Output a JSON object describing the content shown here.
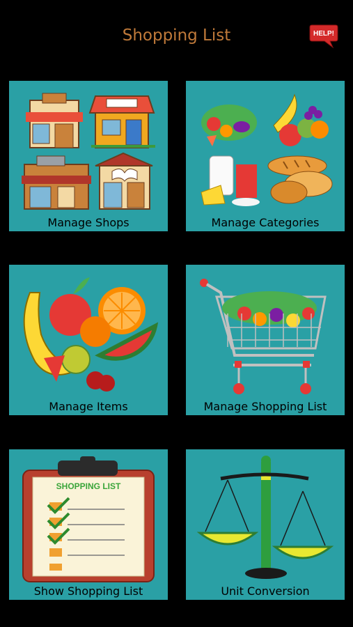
{
  "header": {
    "title": "Shopping List",
    "help_label": "HELP!"
  },
  "tiles": [
    {
      "label": "Manage Shops",
      "icon": "shops-icon"
    },
    {
      "label": "Manage Categories",
      "icon": "categories-icon"
    },
    {
      "label": "Manage Items",
      "icon": "fruits-icon"
    },
    {
      "label": "Manage Shopping List",
      "icon": "shopping-cart-icon"
    },
    {
      "label": "Show Shopping List",
      "icon": "clipboard-icon",
      "clipboard_heading": "SHOPPING LIST"
    },
    {
      "label": "Unit Conversion",
      "icon": "scale-icon"
    }
  ],
  "colors": {
    "background": "#000000",
    "title": "#c07a3a",
    "tile": "#2aa0a5",
    "help": "#d42a2a"
  }
}
